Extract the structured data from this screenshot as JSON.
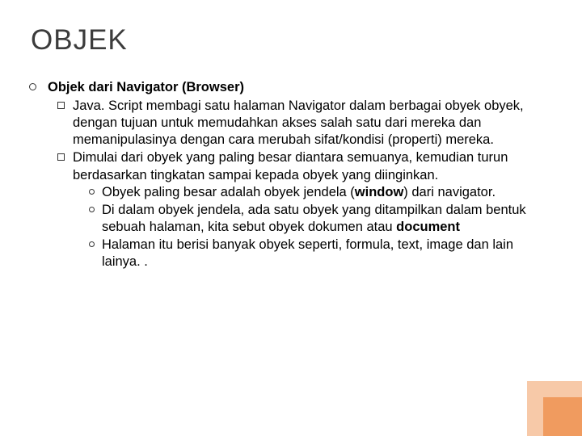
{
  "title": "OBJEK",
  "heading": "Objek dari Navigator (Browser)",
  "sub1": "Java. Script membagi satu halaman Navigator dalam berbagai obyek obyek, dengan tujuan untuk memudahkan akses salah satu dari mereka dan memanipulasinya dengan cara merubah sifat/kondisi (properti) mereka.",
  "sub2": "Dimulai dari obyek yang paling besar diantara semuanya, kemudian turun berdasarkan tingkatan sampai kepada obyek yang diinginkan.",
  "sub2_1_a": "Obyek paling besar adalah obyek jendela (",
  "sub2_1_b": "window",
  "sub2_1_c": ") dari navigator.",
  "sub2_2_a": "Di dalam obyek jendela, ada satu obyek yang ditampilkan dalam bentuk sebuah halaman, kita sebut obyek dokumen atau ",
  "sub2_2_b": "document",
  "sub2_3": "Halaman itu berisi banyak obyek seperti, formula, text, image dan lain lainya. ."
}
